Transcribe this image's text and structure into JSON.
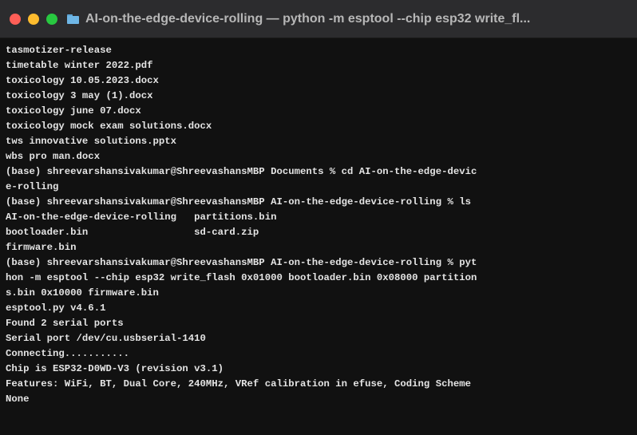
{
  "window": {
    "title": "AI-on-the-edge-device-rolling — python -m esptool --chip esp32 write_fl...",
    "buttons": [
      {
        "name": "close",
        "color": "#ff5f57"
      },
      {
        "name": "minimize",
        "color": "#febc2e"
      },
      {
        "name": "zoom",
        "color": "#28c840"
      }
    ],
    "folder_icon": "folder-icon"
  },
  "terminal": {
    "lines": [
      "tasmotizer-release",
      "timetable winter 2022.pdf",
      "toxicology 10.05.2023.docx",
      "toxicology 3 may (1).docx",
      "toxicology june 07.docx",
      "toxicology mock exam solutions.docx",
      "tws innovative solutions.pptx",
      "wbs pro man.docx",
      "(base) shreevarshansivakumar@ShreevashansMBP Documents % cd AI-on-the-edge-devic",
      "e-rolling",
      "(base) shreevarshansivakumar@ShreevashansMBP AI-on-the-edge-device-rolling % ls",
      "AI-on-the-edge-device-rolling   partitions.bin",
      "bootloader.bin                  sd-card.zip",
      "firmware.bin",
      "(base) shreevarshansivakumar@ShreevashansMBP AI-on-the-edge-device-rolling % pyt",
      "hon -m esptool --chip esp32 write_flash 0x01000 bootloader.bin 0x08000 partition",
      "s.bin 0x10000 firmware.bin",
      "esptool.py v4.6.1",
      "Found 2 serial ports",
      "Serial port /dev/cu.usbserial-1410",
      "Connecting...........",
      "Chip is ESP32-D0WD-V3 (revision v3.1)",
      "Features: WiFi, BT, Dual Core, 240MHz, VRef calibration in efuse, Coding Scheme",
      "None"
    ]
  }
}
